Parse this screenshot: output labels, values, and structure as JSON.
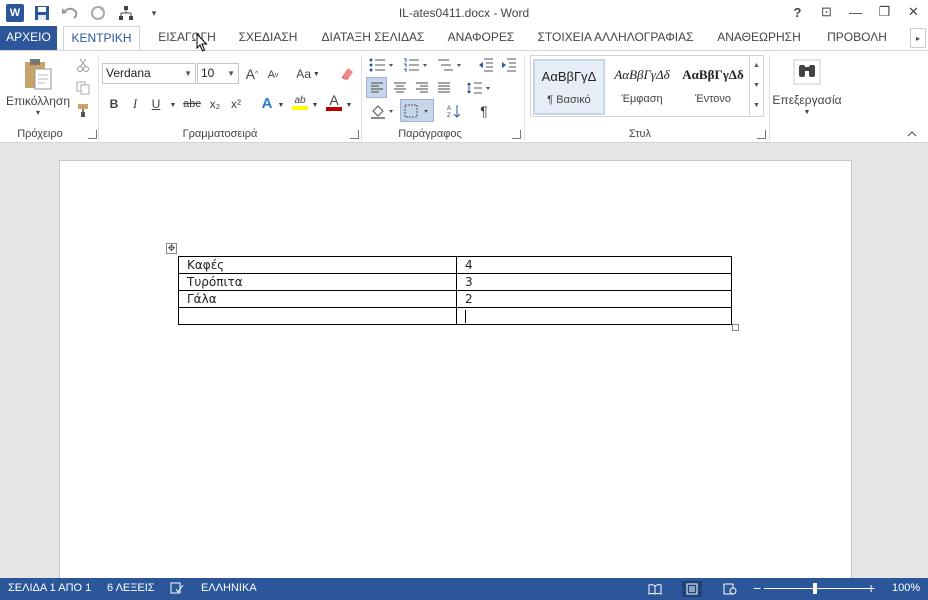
{
  "window": {
    "title": "IL-ates0411.docx - Word",
    "controls": {
      "help": "?",
      "ribbon_options": "⊡",
      "minimize": "—",
      "restore": "❐",
      "close": "✕"
    }
  },
  "qat": {
    "app_icon": "W",
    "save": "save-icon",
    "undo": "undo-icon",
    "redo": "redo-icon",
    "custom": "sitemap-icon",
    "customize": "▾"
  },
  "tabs": {
    "file": "ΑΡΧΕΙΟ",
    "items": [
      "ΚΕΝΤΡΙΚΗ",
      "ΕΙΣΑΓΩΓΗ",
      "ΣΧΕΔΙΑΣΗ",
      "ΔΙΑΤΑΞΗ ΣΕΛΙΔΑΣ",
      "ΑΝΑΦΟΡΕΣ",
      "ΣΤΟΙΧΕΙΑ ΑΛΛΗΛΟΓΡΑΦΙΑΣ",
      "ΑΝΑΘΕΩΡΗΣΗ",
      "ΠΡΟΒΟΛΗ"
    ],
    "active": "ΚΕΝΤΡΙΚΗ",
    "scroll": "▸"
  },
  "ribbon": {
    "clipboard": {
      "label": "Πρόχειρο",
      "paste": "Επικόλληση",
      "paste_arrow": "▾"
    },
    "font": {
      "label": "Γραμματοσειρά",
      "font_name": "Verdana",
      "font_size": "10",
      "grow": "A",
      "shrink": "A",
      "case": "Aa",
      "bold": "B",
      "italic": "I",
      "underline": "U",
      "strike": "abc",
      "subscript": "x₂",
      "superscript": "x²",
      "effects": "A",
      "highlight": "ab",
      "font_color": "A",
      "highlight_color": "#ffff00",
      "font_color_value": "#c00000"
    },
    "paragraph": {
      "label": "Παράγραφος",
      "show_marks": "¶"
    },
    "styles": {
      "label": "Στυλ",
      "items": [
        {
          "preview": "ΑαΒβΓγΔ",
          "name": "¶ Βασικό"
        },
        {
          "preview": "ΑαΒβΓγΔδ",
          "name": "Έμφαση"
        },
        {
          "preview": "ΑαΒβΓγΔδ",
          "name": "Έντονο"
        }
      ]
    },
    "editing": {
      "label": "Επεξεργασία"
    }
  },
  "document": {
    "table": [
      [
        "Καφές",
        "4"
      ],
      [
        "Τυρόπιτα",
        "3"
      ],
      [
        "Γάλα",
        "2"
      ],
      [
        "",
        ""
      ]
    ]
  },
  "status": {
    "page": "ΣΕΛΙΔΑ 1 ΑΠΟ 1",
    "words": "6 ΛΕΞΕΙΣ",
    "language": "ΕΛΛΗΝΙΚΑ",
    "zoom": "100%",
    "zoom_minus": "−",
    "zoom_plus": "+"
  },
  "colors": {
    "accent": "#2b579a"
  }
}
